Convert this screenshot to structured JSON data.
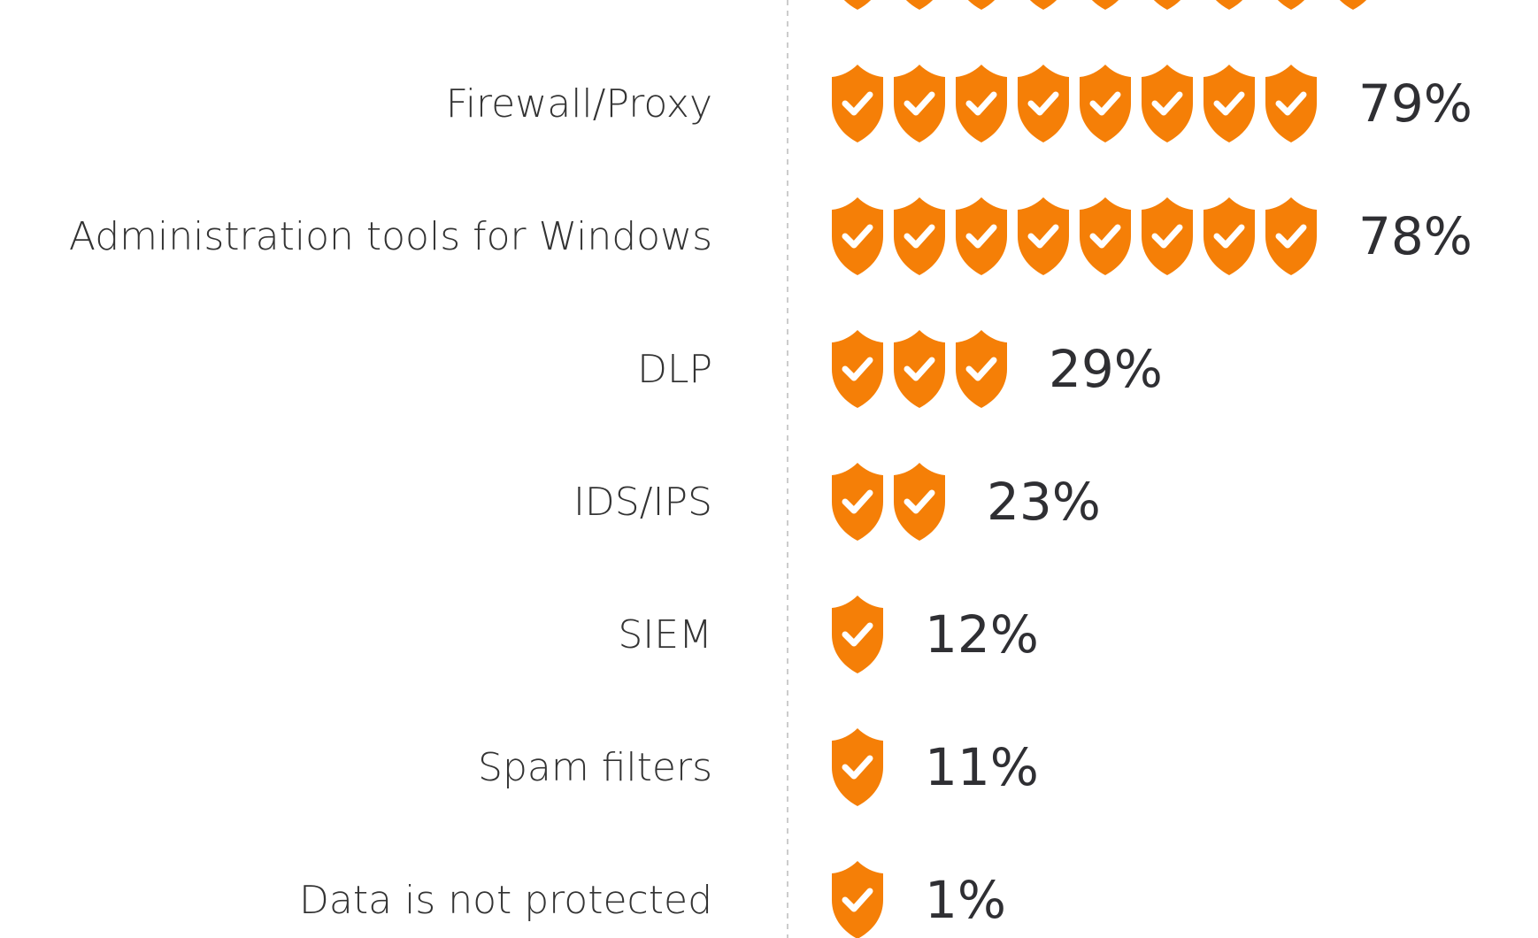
{
  "colors": {
    "shield": "#f57f07",
    "check": "#ffffff",
    "text": "#333333",
    "value_text": "#2f2f33",
    "divider": "#cccccc"
  },
  "icon": "shield-check-icon",
  "chart_data": {
    "type": "bar",
    "title": "",
    "xlabel": "",
    "ylabel": "",
    "unit": "%",
    "categories": [
      "",
      "Firewall/Proxy",
      "Administration tools for Windows",
      "DLP",
      "IDS/IPS",
      "SIEM",
      "Spam filters",
      "Data is not protected"
    ],
    "values": [
      null,
      79,
      78,
      29,
      23,
      12,
      11,
      1
    ],
    "value_labels": [
      "",
      "79%",
      "78%",
      "29%",
      "23%",
      "12%",
      "11%",
      "1%"
    ],
    "icon_counts": [
      9,
      8,
      8,
      3,
      2,
      1,
      1,
      1
    ],
    "grid": false,
    "legend": "none"
  }
}
